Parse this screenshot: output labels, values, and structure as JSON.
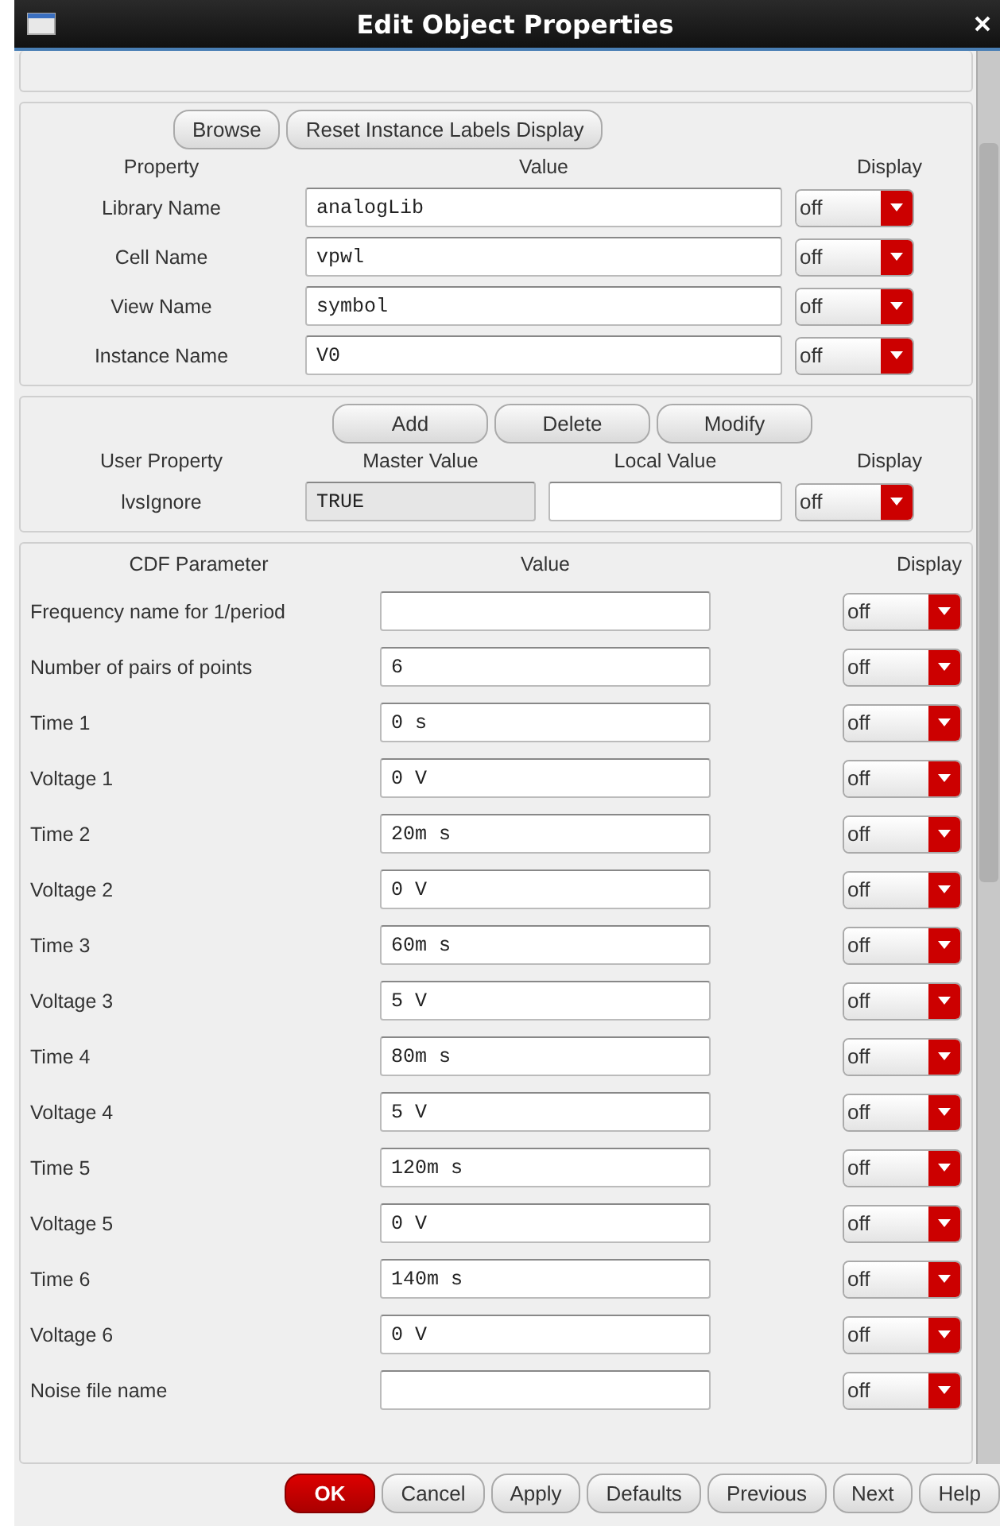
{
  "window": {
    "title": "Edit Object Properties"
  },
  "property_panel": {
    "buttons": [
      "Browse",
      "Reset Instance Labels Display"
    ],
    "columns": [
      "Property",
      "Value",
      "Display"
    ],
    "rows": [
      {
        "label": "Library Name",
        "value": "analogLib",
        "display": "off"
      },
      {
        "label": "Cell Name",
        "value": "vpwl",
        "display": "off"
      },
      {
        "label": "View Name",
        "value": "symbol",
        "display": "off"
      },
      {
        "label": "Instance Name",
        "value": "V0",
        "display": "off"
      }
    ]
  },
  "user_property_panel": {
    "buttons": [
      "Add",
      "Delete",
      "Modify"
    ],
    "columns": [
      "User Property",
      "Master Value",
      "Local Value",
      "Display"
    ],
    "rows": [
      {
        "label": "lvsIgnore",
        "master_value": "TRUE",
        "local_value": "",
        "display": "off"
      }
    ]
  },
  "cdf_panel": {
    "columns": [
      "CDF Parameter",
      "Value",
      "Display"
    ],
    "rows": [
      {
        "label": "Frequency name for 1/period",
        "value": "",
        "display": "off"
      },
      {
        "label": "Number of pairs of points",
        "value": "6",
        "display": "off"
      },
      {
        "label": "Time 1",
        "value": "0 s",
        "display": "off"
      },
      {
        "label": "Voltage 1",
        "value": "0 V",
        "display": "off"
      },
      {
        "label": "Time 2",
        "value": "20m s",
        "display": "off"
      },
      {
        "label": "Voltage 2",
        "value": "0 V",
        "display": "off"
      },
      {
        "label": "Time 3",
        "value": "60m s",
        "display": "off"
      },
      {
        "label": "Voltage 3",
        "value": "5 V",
        "display": "off"
      },
      {
        "label": "Time 4",
        "value": "80m s",
        "display": "off"
      },
      {
        "label": "Voltage 4",
        "value": "5 V",
        "display": "off"
      },
      {
        "label": "Time 5",
        "value": "120m s",
        "display": "off"
      },
      {
        "label": "Voltage 5",
        "value": "0 V",
        "display": "off"
      },
      {
        "label": "Time 6",
        "value": "140m s",
        "display": "off"
      },
      {
        "label": "Voltage 6",
        "value": "0 V",
        "display": "off"
      },
      {
        "label": "Noise file name",
        "value": "",
        "display": "off"
      }
    ]
  },
  "dialog_buttons": [
    {
      "label": "OK",
      "kind": "default"
    },
    {
      "label": "Cancel",
      "kind": "normal"
    },
    {
      "label": "Apply",
      "kind": "normal"
    },
    {
      "label": "Defaults",
      "kind": "normal"
    },
    {
      "label": "Previous",
      "kind": "normal"
    },
    {
      "label": "Next",
      "kind": "normal"
    },
    {
      "label": "Help",
      "kind": "normal"
    }
  ]
}
